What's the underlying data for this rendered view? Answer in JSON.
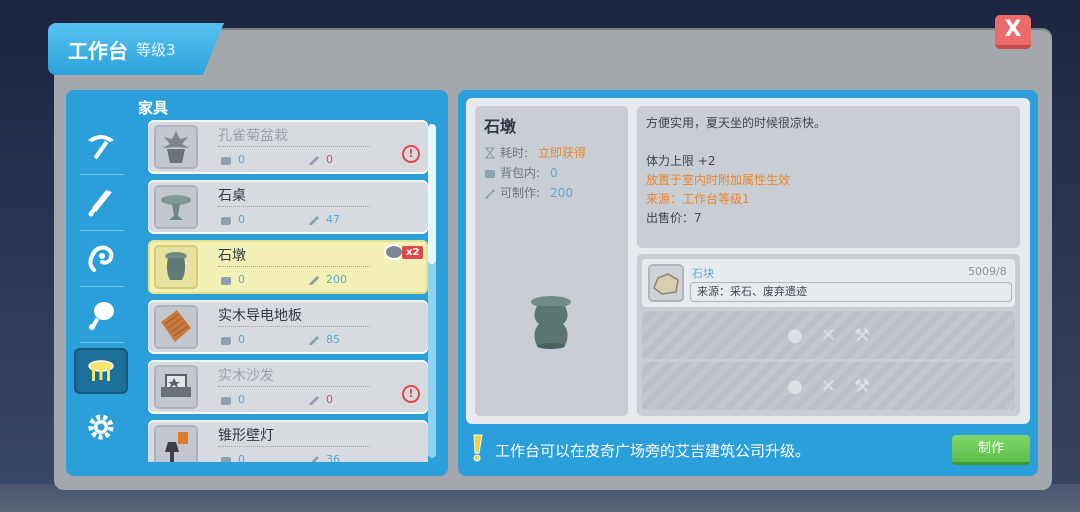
{
  "window": {
    "title": "工作台",
    "level": "等级3",
    "close_label": "X"
  },
  "sidebar": {
    "tabs": [
      {
        "icon": "pickaxe-icon"
      },
      {
        "icon": "sword-icon"
      },
      {
        "icon": "ear-icon"
      },
      {
        "icon": "food-icon"
      },
      {
        "icon": "furniture-icon",
        "active": true
      },
      {
        "icon": "gear-icon"
      }
    ]
  },
  "list": {
    "category": "家具",
    "items": [
      {
        "name": "孔雀菊盆栽",
        "bag": "0",
        "make": "0",
        "make_red": true,
        "warning": true,
        "disabled": true,
        "icon": "potted-plant-icon"
      },
      {
        "name": "石桌",
        "bag": "0",
        "make": "47",
        "icon": "stone-table-icon"
      },
      {
        "name": "石墩",
        "bag": "0",
        "make": "200",
        "active": true,
        "badge": "x2",
        "icon": "stone-stool-icon"
      },
      {
        "name": "实木导电地板",
        "bag": "0",
        "make": "85",
        "icon": "wood-floor-icon"
      },
      {
        "name": "实木沙发",
        "bag": "0",
        "make": "0",
        "make_red": true,
        "warning": true,
        "disabled": true,
        "icon": "sofa-icon"
      },
      {
        "name": "锥形壁灯",
        "bag": "0",
        "make": "36",
        "icon": "wall-lamp-icon"
      }
    ]
  },
  "detail": {
    "name": "石墩",
    "time_label": "耗时:",
    "time_value": "立即获得",
    "bag_label": "背包内:",
    "bag_value": "0",
    "craftable_label": "可制作:",
    "craftable_value": "200",
    "description": "方便实用，夏天坐的时候很凉快。",
    "stat": "体力上限 +2",
    "effect": "放置于室内时附加属性生效",
    "source": "来源：工作台等级1",
    "price": "出售价：7"
  },
  "materials": [
    {
      "name": "石块",
      "count": "5009/8",
      "source": "来源：采石、废弃遗迹"
    }
  ],
  "footer": {
    "tip": "工作台可以在皮奇广场旁的艾吉建筑公司升级。",
    "make_button": "制作"
  },
  "colors": {
    "accent": "#2b9fd9",
    "make_button": "#5cbf48",
    "close_button": "#ec6a6a",
    "highlight": "#e8852b"
  }
}
